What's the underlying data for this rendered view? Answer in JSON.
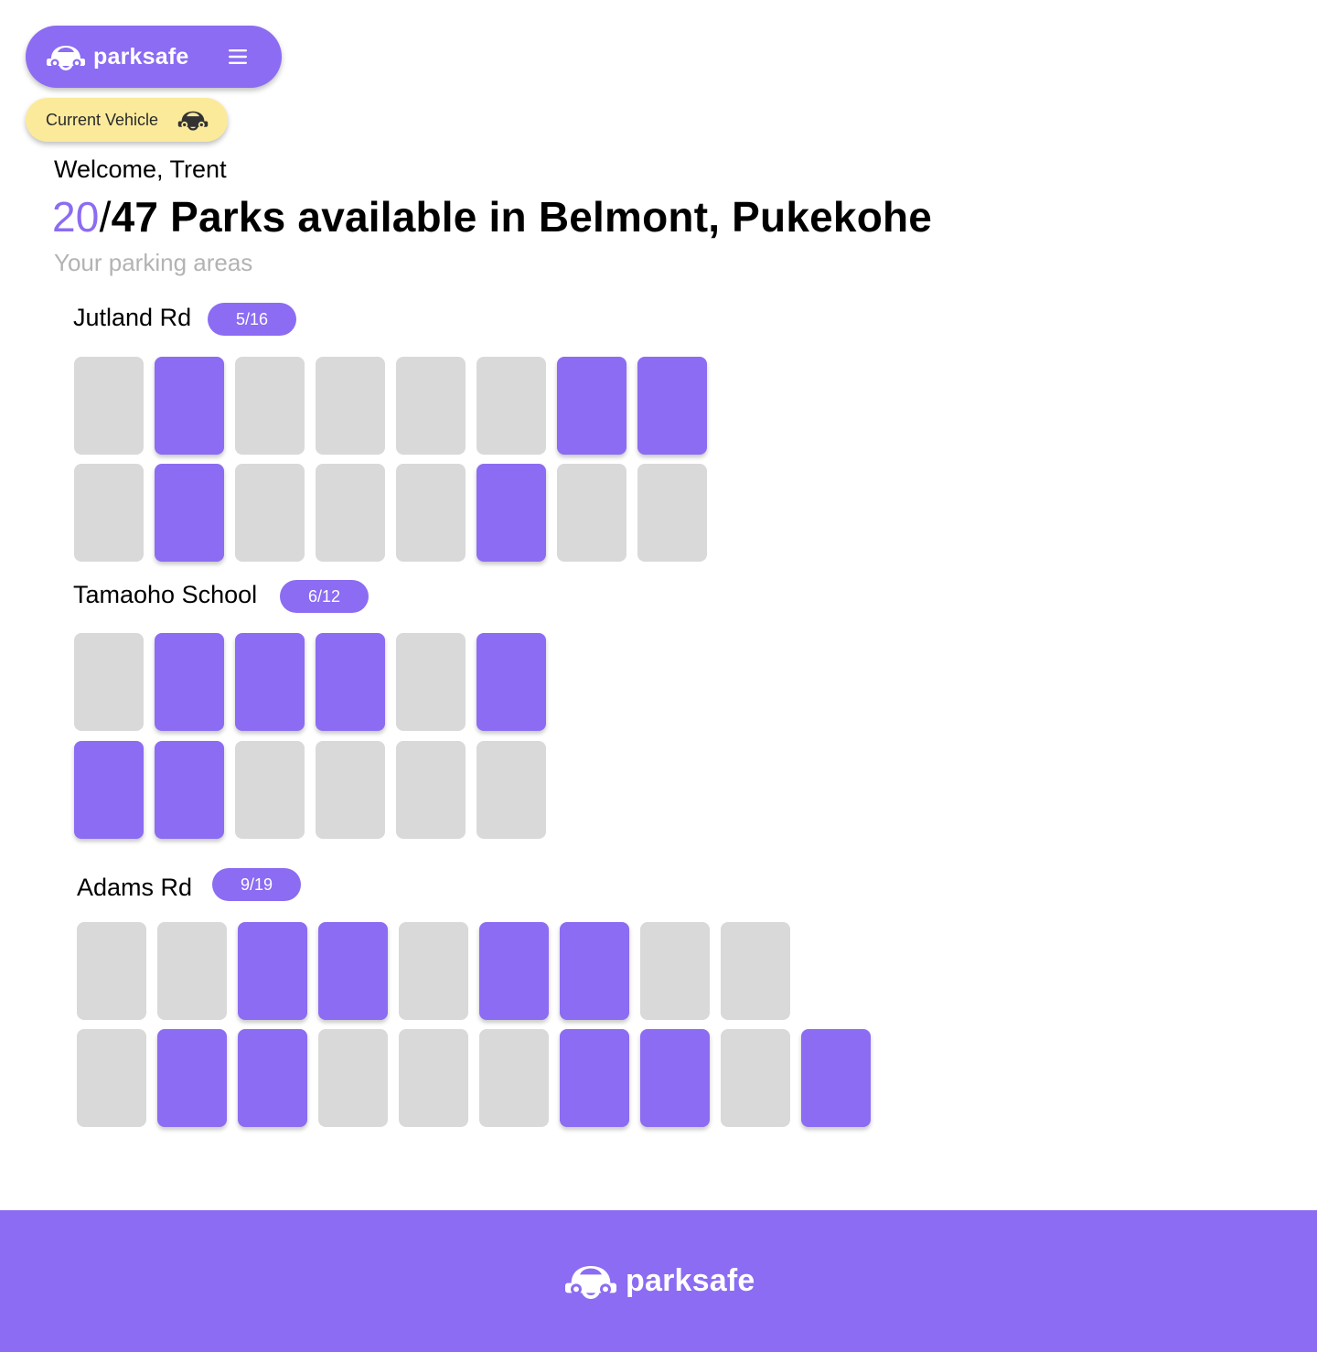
{
  "brand": {
    "name": "parksafe",
    "logo_icon": "car-smile-icon",
    "primary_color": "#8B6CF2",
    "accent_color": "#FCEA9B"
  },
  "header": {
    "menu_icon": "hamburger-menu-icon",
    "current_vehicle_label": "Current Vehicle",
    "vehicle_icon": "car-icon"
  },
  "greeting": "Welcome, Trent",
  "summary": {
    "available": "20",
    "separator": "/",
    "rest": "47 Parks available in Belmont, Pukekohe"
  },
  "areas_heading": "Your parking areas",
  "areas": [
    {
      "name": "Jutland Rd",
      "badge": "5/16",
      "rows": [
        [
          0,
          1,
          0,
          0,
          0,
          0,
          1,
          1
        ],
        [
          0,
          1,
          0,
          0,
          0,
          1,
          0,
          0
        ]
      ]
    },
    {
      "name": "Tamaoho School",
      "badge": "6/12",
      "rows": [
        [
          0,
          1,
          1,
          1,
          0,
          1
        ],
        [
          1,
          1,
          0,
          0,
          0,
          0
        ]
      ]
    },
    {
      "name": "Adams Rd",
      "badge": "9/19",
      "rows": [
        [
          0,
          0,
          1,
          1,
          0,
          1,
          1,
          0,
          0
        ],
        [
          0,
          1,
          1,
          0,
          0,
          0,
          1,
          1,
          0,
          1
        ]
      ]
    }
  ],
  "footer": {
    "brand": "parksafe"
  }
}
